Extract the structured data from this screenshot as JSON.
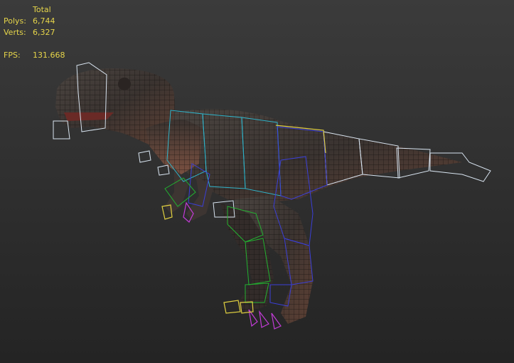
{
  "stats": {
    "header": "Total",
    "polys_label": "Polys:",
    "polys_value": "6,744",
    "verts_label": "Verts:",
    "verts_value": "6,327",
    "fps_label": "FPS:",
    "fps_value": "131.668"
  },
  "colors": {
    "background": "#333333",
    "stats_text": "#e6d54a",
    "bone_white": "#d8e4f0",
    "bone_cyan": "#2fb3c9",
    "bone_blue": "#3b3fd8",
    "bone_green": "#22b030",
    "bone_magenta": "#c23bd6",
    "bone_yellow": "#e0d040",
    "skin_dark": "#3a3432",
    "skin_warm": "#6b4a3c"
  }
}
